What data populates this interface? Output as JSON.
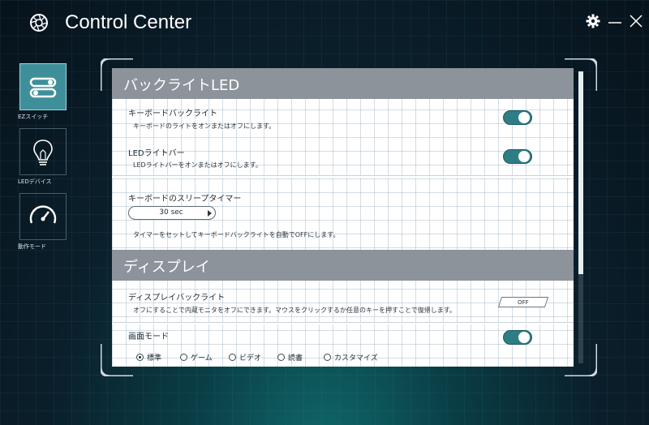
{
  "app": {
    "title": "Control Center"
  },
  "sidebar": {
    "items": [
      {
        "label": "EZスイッチ",
        "icon": "toggle-switches-icon",
        "active": true
      },
      {
        "label": "LEDデバイス",
        "icon": "lightbulb-icon",
        "active": false
      },
      {
        "label": "動作モード",
        "icon": "speedometer-icon",
        "active": false
      }
    ]
  },
  "sections": {
    "backlight": {
      "header": "バックライトLED",
      "keyboard": {
        "title": "キーボードバックライト",
        "desc": "キーボードのライトをオンまたはオフにします。",
        "on": true
      },
      "led_bar": {
        "title": "LEDライトバー",
        "desc": "LEDライトバーをオンまたはオフにします。",
        "on": true
      },
      "sleep_timer": {
        "title": "キーボードのスリープタイマー",
        "value": "30 sec",
        "desc": "タイマーをセットしてキーボードバックライトを自動でOFFにします。"
      }
    },
    "display": {
      "header": "ディスプレイ",
      "backlight": {
        "title": "ディスプレイバックライト",
        "desc": "オフにすることで内蔵モニタをオフにできます。マウスをクリックするか任意のキーを押すことで復帰します。",
        "button": "OFF"
      },
      "screen_mode": {
        "title": "画面モード",
        "on": true,
        "options": [
          "標準",
          "ゲーム",
          "ビデオ",
          "読書",
          "カスタマイズ"
        ],
        "selected": "標準"
      }
    }
  },
  "colors": {
    "accent": "#2f7d84",
    "section_header": "#8d939a",
    "active_sidebar": "#3f8f9a"
  }
}
